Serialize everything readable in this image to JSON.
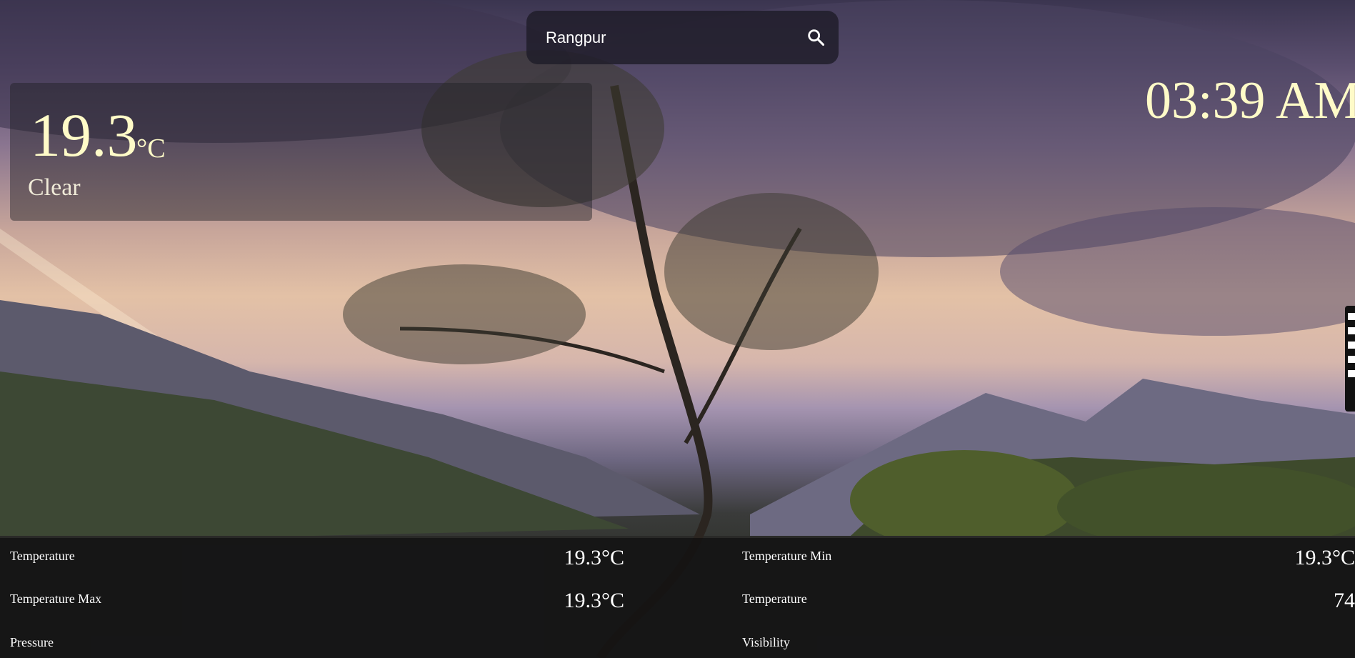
{
  "search": {
    "value": "Rangpur"
  },
  "current": {
    "temperature": "19.3",
    "unit": "°C",
    "condition": "Clear"
  },
  "clock": {
    "time": "03:39 AM"
  },
  "details": [
    {
      "label": "Temperature",
      "value": "19.3°C"
    },
    {
      "label": "Temperature Min",
      "value": "19.3°C"
    },
    {
      "label": "Temperature Max",
      "value": "19.3°C"
    },
    {
      "label": "Temperature",
      "value": "74"
    },
    {
      "label": "Pressure",
      "value": ""
    },
    {
      "label": "Visibility",
      "value": ""
    }
  ],
  "colors": {
    "accent": "#fffbc8",
    "panel": "#1e1e23"
  },
  "icons": {
    "search": "search-icon"
  }
}
